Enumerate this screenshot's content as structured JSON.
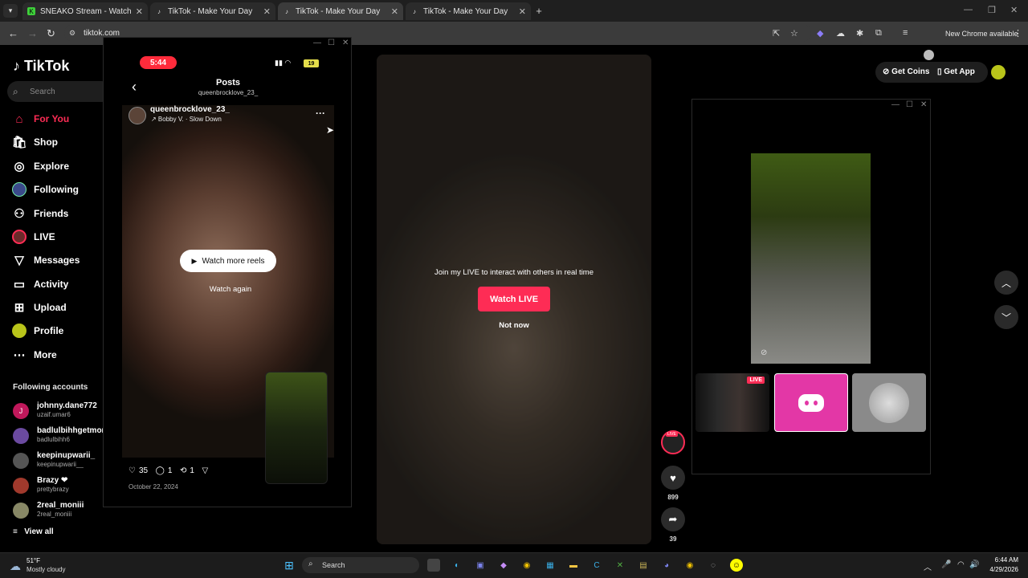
{
  "browser": {
    "tabs": [
      {
        "title": "SNEAKO Stream - Watch Live o",
        "favicon": "K"
      },
      {
        "title": "TikTok - Make Your Day",
        "favicon": "♪"
      },
      {
        "title": "TikTok - Make Your Day",
        "favicon": "♪"
      },
      {
        "title": "TikTok - Make Your Day",
        "favicon": "♪"
      }
    ],
    "active_tab": 2,
    "url": "tiktok.com",
    "new_chrome": "New Chrome available"
  },
  "sidebar": {
    "logo": "TikTok",
    "search_placeholder": "Search",
    "nav": [
      {
        "label": "For You",
        "icon": "home-icon",
        "glyph": "⌂"
      },
      {
        "label": "Shop",
        "icon": "shop-icon",
        "glyph": "🛍"
      },
      {
        "label": "Explore",
        "icon": "compass-icon",
        "glyph": "◎"
      },
      {
        "label": "Following",
        "icon": "following-avatar-icon",
        "glyph": "●"
      },
      {
        "label": "Friends",
        "icon": "friends-icon",
        "glyph": "👥"
      },
      {
        "label": "LIVE",
        "icon": "live-icon",
        "glyph": "◉"
      },
      {
        "label": "Messages",
        "icon": "messages-icon",
        "glyph": "▽"
      },
      {
        "label": "Activity",
        "icon": "activity-icon",
        "glyph": "▭"
      },
      {
        "label": "Upload",
        "icon": "upload-icon",
        "glyph": "⊞"
      },
      {
        "label": "Profile",
        "icon": "profile-icon",
        "glyph": "●"
      },
      {
        "label": "More",
        "icon": "more-icon",
        "glyph": "⋯"
      }
    ],
    "following_title": "Following accounts",
    "following": [
      {
        "name": "johnny.dane772",
        "user": "uzaif.umar6",
        "color": "#c0185b"
      },
      {
        "name": "badlulbihhgetmone",
        "user": "badlulbihh6",
        "color": "#6b4aa0"
      },
      {
        "name": "keepinupwarii_",
        "user": "keepinupwarii__",
        "color": "#555"
      },
      {
        "name": "Brazy ❤",
        "user": "prettybrazy",
        "color": "#a0392c"
      },
      {
        "name": "2real_moniii",
        "user": "2real_moniii",
        "color": "#886"
      }
    ],
    "view_all": "View all"
  },
  "phone": {
    "time": "5:44",
    "battery": "19",
    "title": "Posts",
    "username": "queenbrocklove_23_",
    "post_author": "queenbrocklove_23_",
    "post_music": "↗ Bobby V. · Slow Down",
    "watch_more": "Watch more reels",
    "watch_again": "Watch again",
    "likes": "35",
    "comments": "1",
    "reposts": "1",
    "date": "October 22, 2024"
  },
  "video": {
    "prompt": "Join my LIVE to interact with others in real time",
    "watch_live": "Watch LIVE",
    "not_now": "Not now",
    "live_tag": "LIVE",
    "likes": "899",
    "shares": "39"
  },
  "topright": {
    "get_coins": "Get Coins",
    "get_app": "Get App"
  },
  "rightwin": {
    "live_badge": "LIVE"
  },
  "taskbar": {
    "temp": "51°F",
    "weather": "Mostly cloudy",
    "search": "Search",
    "time": "6:44 AM",
    "date": "4/29/2026"
  }
}
